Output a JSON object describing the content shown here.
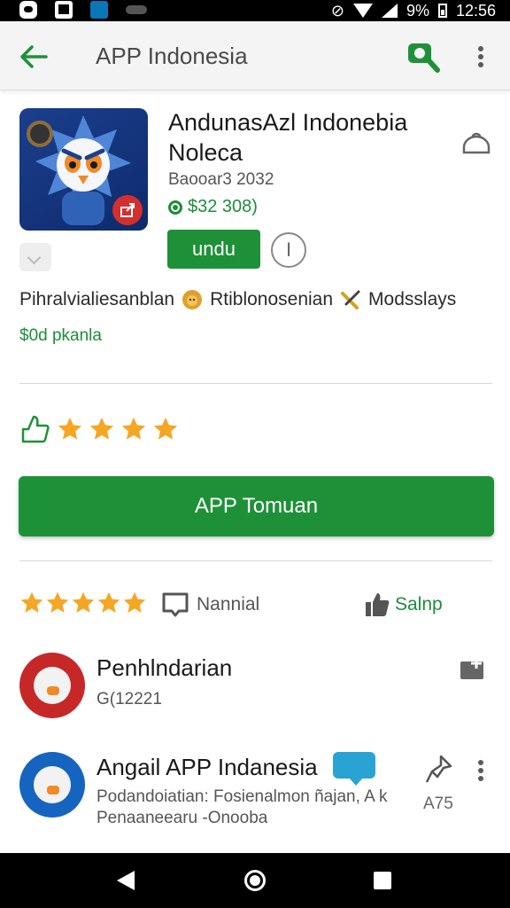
{
  "status_bar": {
    "battery": "9%",
    "time": "12:56"
  },
  "toolbar": {
    "title": "APP Indonesia",
    "back_icon": "arrow-left-icon",
    "search_icon": "search-icon",
    "more_icon": "more-vert-icon"
  },
  "app": {
    "name": "AndunasAzl Indonebia Noleca",
    "developer": "Baooar3 2032",
    "price": "$32 308)",
    "install_label": "undu",
    "info_label": "I"
  },
  "categories": {
    "cat1": "Pihralvialiesanblan",
    "cat2": "Rtiblonosenian",
    "cat3": "Modsslays",
    "offer": "$0d pkanla"
  },
  "primary_button": {
    "label": "APP Tomuan"
  },
  "stats": {
    "review_label": "Nannial",
    "like_label": "Salnp"
  },
  "list": {
    "item1": {
      "title": "Penhlndarian",
      "sub": "G(12221"
    },
    "item2": {
      "title": "Angail APP Indanesia",
      "sub": "Podandoiatian: Fosienalmon ñajan, A k",
      "sub2": "Penaaneearu -Onooba",
      "pin_label": "A75"
    }
  },
  "colors": {
    "brand_green": "#1e9138",
    "star_orange": "#f5a623",
    "toolbar_bg": "#f4f4f4"
  }
}
